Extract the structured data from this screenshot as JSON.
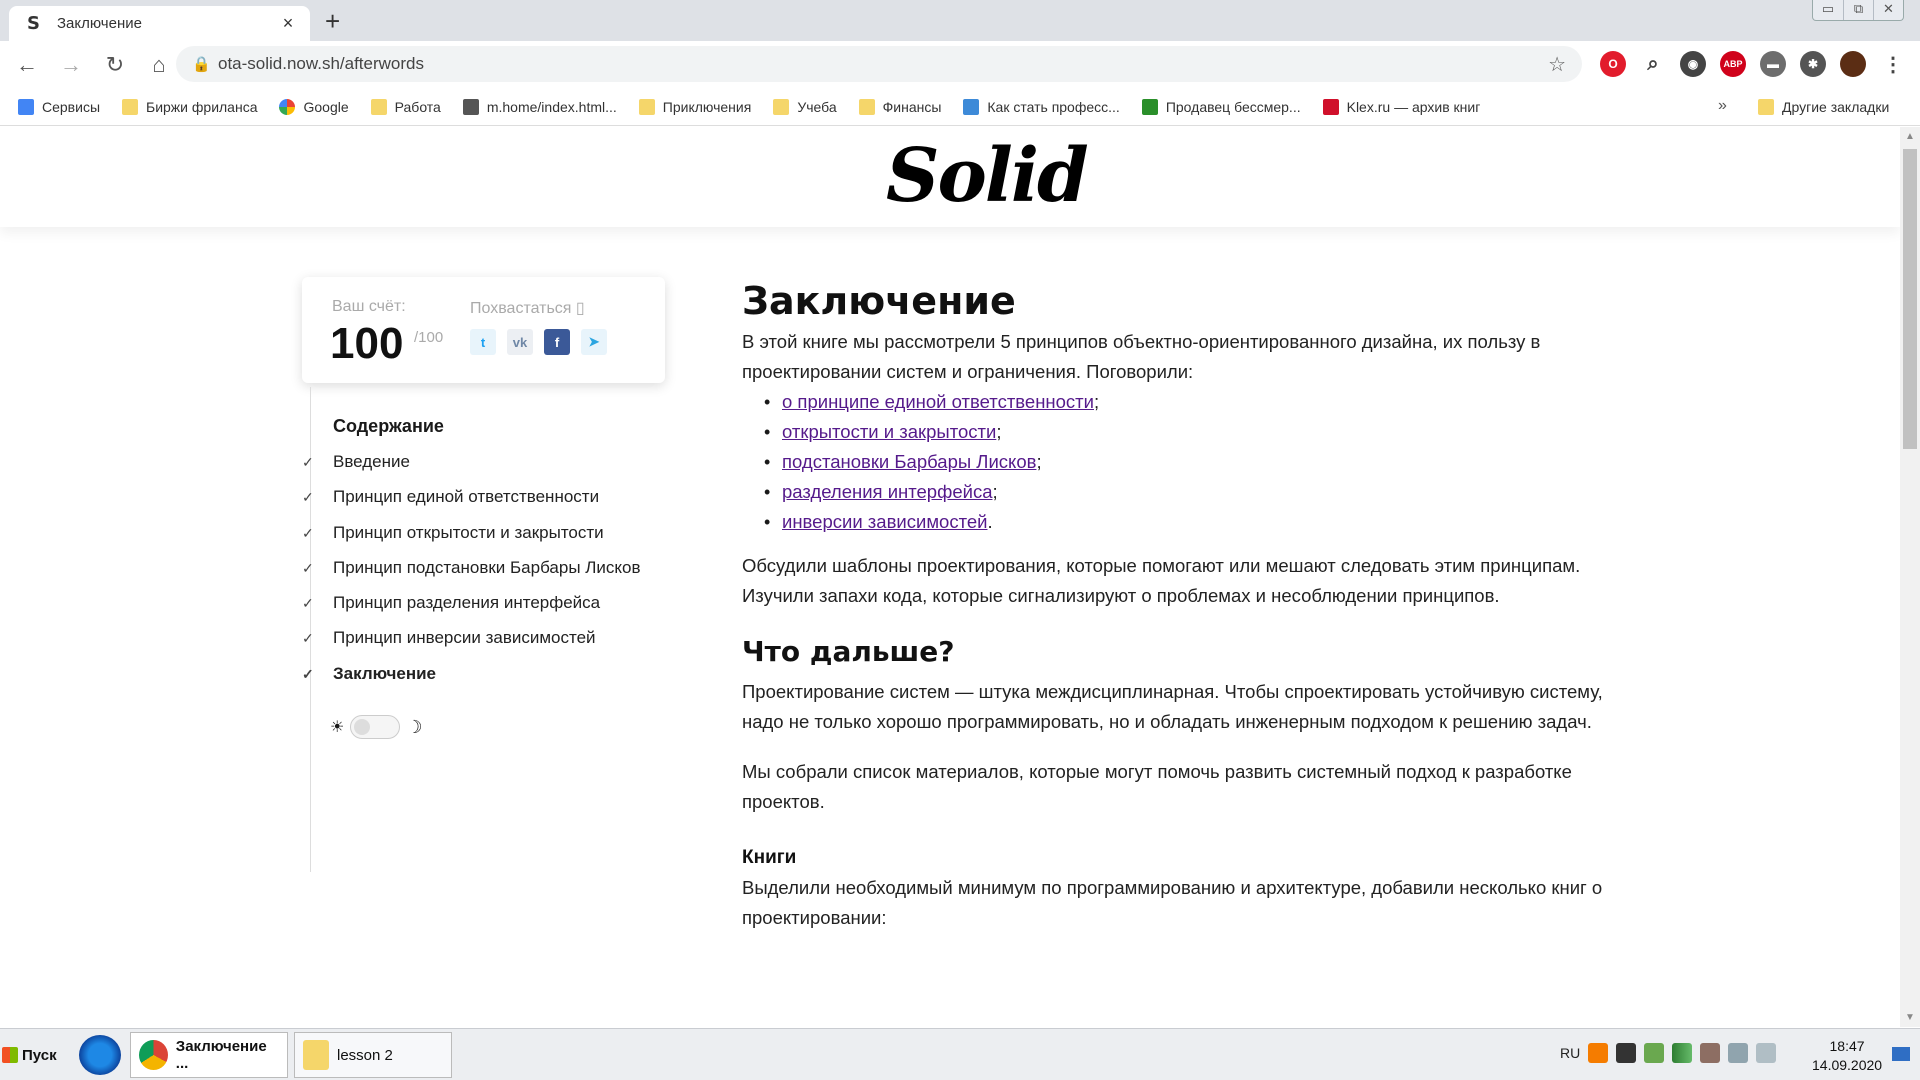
{
  "browser": {
    "tab": {
      "favicon": "S",
      "title": "Заключение",
      "close": "×"
    },
    "new_tab": "+",
    "window_controls": [
      "▭",
      "⧉",
      "✕"
    ],
    "nav": {
      "back": "←",
      "forward": "→",
      "reload": "↻",
      "home": "⌂"
    },
    "url": "ota-solid.now.sh/afterwords",
    "lock": "🔒",
    "star": "☆",
    "extensions": [
      {
        "name": "opera-icon",
        "label": "O",
        "color": "#e21c2c"
      },
      {
        "name": "search-icon",
        "label": "⌕",
        "color": "#ffffff"
      },
      {
        "name": "privacy-icon",
        "label": "◉",
        "color": "#444444"
      },
      {
        "name": "adblock-icon",
        "label": "ABP",
        "color": "#d0021b"
      },
      {
        "name": "hat-icon",
        "label": "▬",
        "color": "#6d6d6d"
      },
      {
        "name": "puzzle-icon",
        "label": "✱",
        "color": "#555555"
      },
      {
        "name": "avatar-icon",
        "label": "",
        "color": "#5b2d14"
      },
      {
        "name": "menu-icon",
        "label": "⋮",
        "color": "#ffffff"
      }
    ]
  },
  "bookmarks": {
    "items": [
      {
        "label": "Сервисы",
        "icon": "apps-icon",
        "color": "#4285f4"
      },
      {
        "label": "Биржи фриланса",
        "icon": "folder-icon",
        "color": "#f5d66a"
      },
      {
        "label": "Google",
        "icon": "google-icon",
        "color": "#ffffff"
      },
      {
        "label": "Работа",
        "icon": "folder-icon",
        "color": "#f5d66a"
      },
      {
        "label": "m.home/index.html...",
        "icon": "laptop-icon",
        "color": "#555555"
      },
      {
        "label": "Приключения",
        "icon": "folder-icon",
        "color": "#f5d66a"
      },
      {
        "label": "Учеба",
        "icon": "folder-icon",
        "color": "#f5d66a"
      },
      {
        "label": "Финансы",
        "icon": "folder-icon",
        "color": "#f5d66a"
      },
      {
        "label": "Как стать професс...",
        "icon": "site-icon",
        "color": "#3d8ad8"
      },
      {
        "label": "Продавец бессмер...",
        "icon": "rt-icon",
        "color": "#2a8f2a"
      },
      {
        "label": "Klex.ru — архив книг",
        "icon": "klex-icon",
        "color": "#d0102b"
      }
    ],
    "more": "»",
    "other": "Другие закладки"
  },
  "site": {
    "logo": "Solid"
  },
  "score": {
    "label": "Ваш счёт:",
    "value": "100",
    "max": "/100",
    "brag": "Похвастаться ▯",
    "social": [
      {
        "name": "twitter-icon",
        "label": "t",
        "bg": "#e8f4fb",
        "fg": "#1da1f2"
      },
      {
        "name": "vk-icon",
        "label": "vk",
        "bg": "#eceff3",
        "fg": "#6f87a6"
      },
      {
        "name": "facebook-icon",
        "label": "f",
        "bg": "#3b5998",
        "fg": "#ffffff"
      },
      {
        "name": "telegram-icon",
        "label": "➤",
        "bg": "#e8f4fb",
        "fg": "#2ca5e0"
      }
    ]
  },
  "toc": {
    "title": "Содержание",
    "check": "✓",
    "items": [
      "Введение",
      "Принцип единой ответственности",
      "Принцип открытости и закрытости",
      "Принцип подстановки Барбары Лисков",
      "Принцип разделения интерфейса",
      "Принцип инверсии зависимостей",
      "Заключение"
    ],
    "theme": {
      "light": "☀",
      "dark": "☽"
    }
  },
  "article": {
    "h1": "Заключение",
    "intro": "В этой книге мы рассмотрели 5 принципов объектно-ориентированного дизайна, их пользу в проектировании систем и ограничения. Поговорили:",
    "bullet": "•",
    "links": [
      {
        "text": "о принципе единой ответственности",
        "after": ";"
      },
      {
        "text": "открытости и закрытости",
        "after": ";"
      },
      {
        "text": "подстановки Барбары Лисков",
        "after": ";"
      },
      {
        "text": "разделения интерфейса",
        "after": ";"
      },
      {
        "text": "инверсии зависимостей",
        "after": "."
      }
    ],
    "p2": "Обсудили шаблоны проектирования, которые помогают или мешают следовать этим принципам. Изучили запахи кода, которые сигнализируют о проблемах и несоблюдении принципов.",
    "h2": "Что дальше?",
    "p3": "Проектирование систем — штука междисциплинарная. Чтобы спроектировать устойчивую систему, надо не только хорошо программировать, но и обладать инженерным подходом к решению задач.",
    "p4": "Мы собрали список материалов, которые могут помочь развить системный подход к разработке проектов.",
    "h3": "Книги",
    "p5": "Выделили необходимый минимум по программированию и архитектуре, добавили несколько книг о проектировании:"
  },
  "taskbar": {
    "start": "Пуск",
    "tasks": [
      {
        "label": "Заключение ...",
        "icon": "chrome-icon"
      },
      {
        "label": "lesson 2",
        "icon": "folder-icon"
      }
    ],
    "lang": "RU",
    "time": "18:47",
    "date": "14.09.2020"
  }
}
